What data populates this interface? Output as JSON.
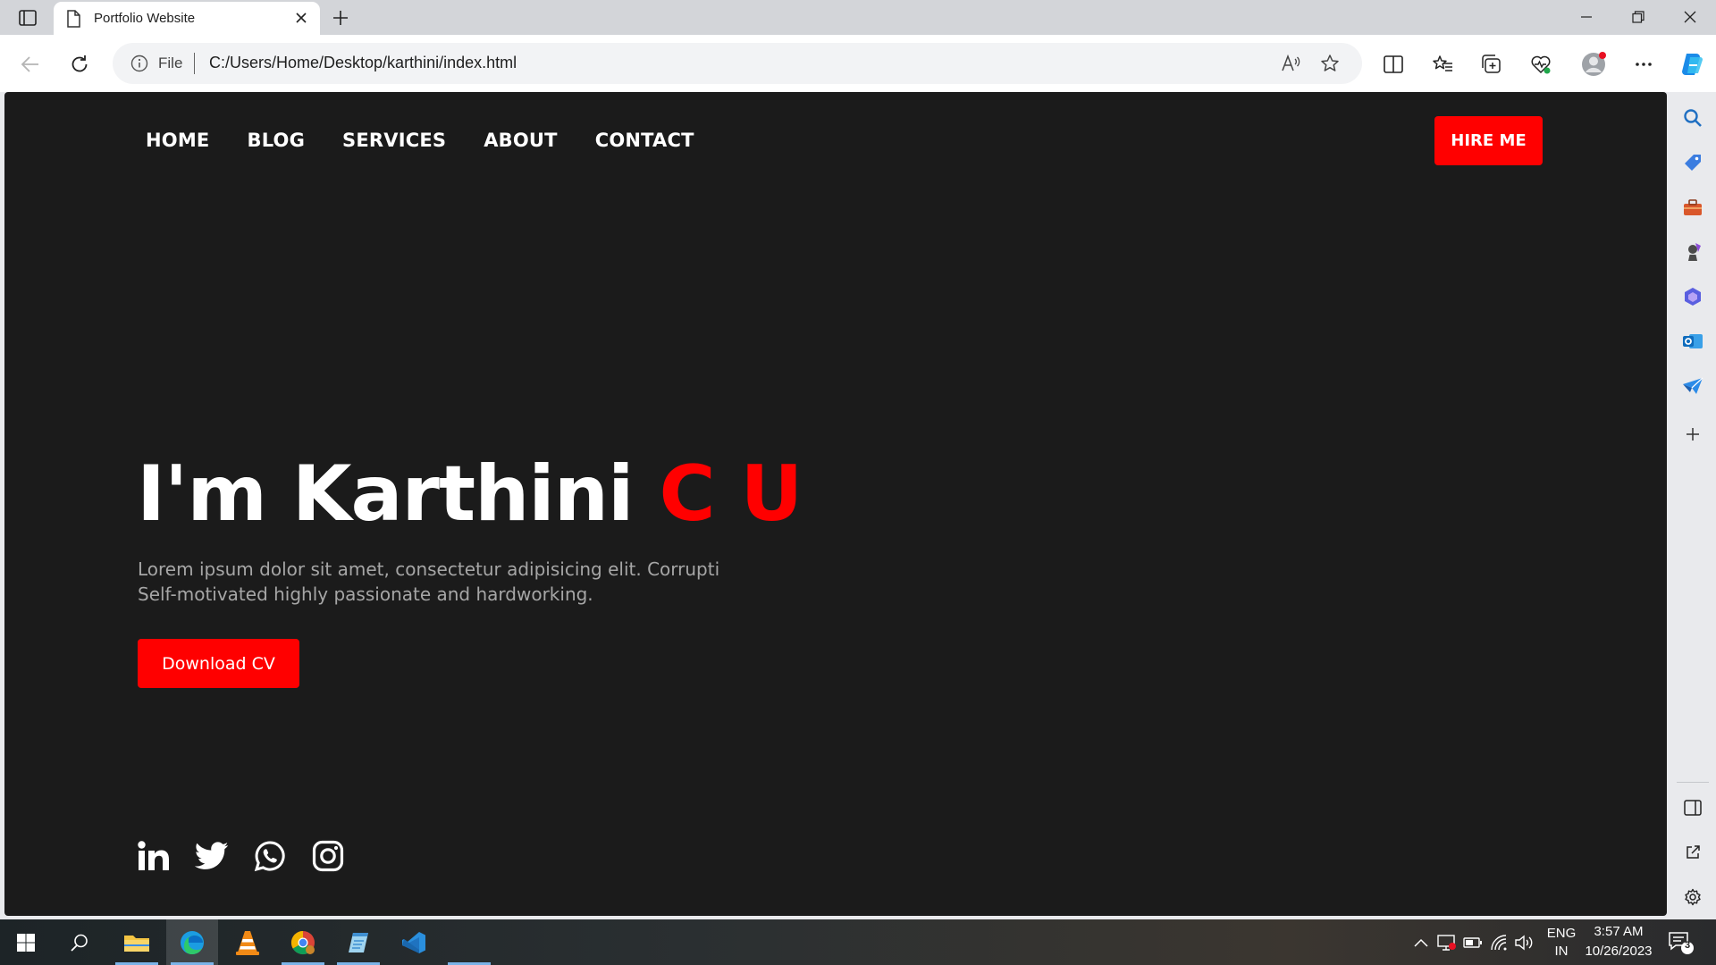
{
  "browser": {
    "tab_title": "Portfolio Website",
    "address_scheme_label": "File",
    "address_url": "C:/Users/Home/Desktop/karthini/index.html"
  },
  "site": {
    "nav": [
      "HOME",
      "BLOG",
      "SERVICES",
      "ABOUT",
      "CONTACT"
    ],
    "hire_label": "HIRE ME",
    "hero_prefix": "I'm Karthini ",
    "hero_accent": "C U",
    "desc_line1": "Lorem ipsum dolor sit amet, consectetur adipisicing elit. Corrupti",
    "desc_line2": "Self-motivated highly passionate and hardworking.",
    "cv_label": "Download CV",
    "socials": [
      "linkedin-icon",
      "twitter-icon",
      "whatsapp-icon",
      "instagram-icon"
    ]
  },
  "colors": {
    "accent": "#ff0000",
    "site_bg": "#1b1b1b"
  },
  "taskbar": {
    "lang_top": "ENG",
    "lang_bottom": "IN",
    "time": "3:57 AM",
    "date": "10/26/2023",
    "notification_count": "3"
  }
}
